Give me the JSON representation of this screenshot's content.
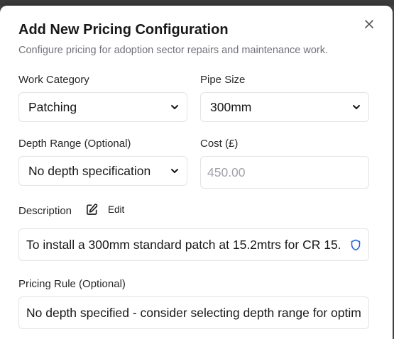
{
  "dialog": {
    "title": "Add New Pricing Configuration",
    "subtitle": "Configure pricing for adoption sector repairs and maintenance work."
  },
  "form": {
    "work_category": {
      "label": "Work Category",
      "value": "Patching"
    },
    "pipe_size": {
      "label": "Pipe Size",
      "value": "300mm"
    },
    "depth_range": {
      "label": "Depth Range (Optional)",
      "value": "No depth specification"
    },
    "cost": {
      "label": "Cost (£)",
      "placeholder": "450.00"
    },
    "description": {
      "label": "Description",
      "edit_label": "Edit",
      "value": "To install a 300mm standard patch at 15.2mtrs for CR 15."
    },
    "pricing_rule": {
      "label": "Pricing Rule (Optional)",
      "value": "No depth specified - consider selecting depth range for optimal pricing"
    }
  },
  "icons": {
    "close": "close-icon",
    "edit": "pencil-square-icon",
    "shield": "shield-icon",
    "chevron": "chevron-down-icon"
  },
  "colors": {
    "accent": "#2563eb"
  }
}
